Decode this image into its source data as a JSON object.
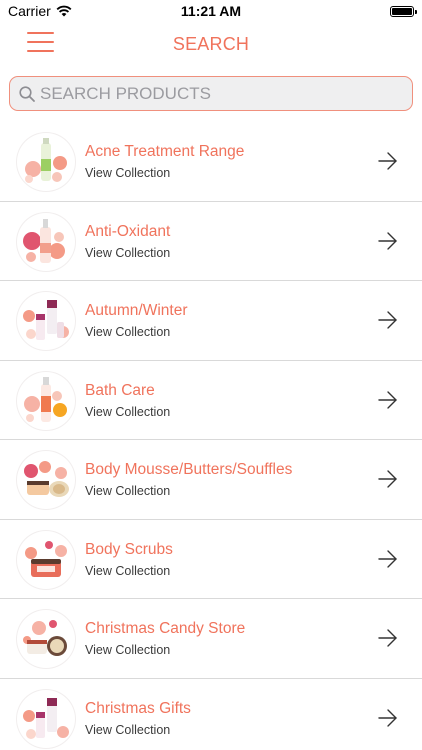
{
  "status_bar": {
    "carrier": "Carrier",
    "time": "11:21 AM"
  },
  "nav": {
    "title": "SEARCH",
    "menu_icon": "hamburger-menu-icon"
  },
  "search": {
    "placeholder": "SEARCH PRODUCTS",
    "value": ""
  },
  "collections": [
    {
      "title": "Acne Treatment Range",
      "subtitle": "View Collection",
      "thumbnail": "bottle-with-flowers"
    },
    {
      "title": "Anti-Oxidant",
      "subtitle": "View Collection",
      "thumbnail": "spray-bottle-with-flowers"
    },
    {
      "title": "Autumn/Winter",
      "subtitle": "View Collection",
      "thumbnail": "product-set-with-flowers"
    },
    {
      "title": "Bath Care",
      "subtitle": "View Collection",
      "thumbnail": "tall-bottle-with-flowers"
    },
    {
      "title": "Body Mousse/Butters/Souffles",
      "subtitle": "View Collection",
      "thumbnail": "jars-with-flowers"
    },
    {
      "title": "Body Scrubs",
      "subtitle": "View Collection",
      "thumbnail": "scrub-jar-with-flowers"
    },
    {
      "title": "Christmas Candy Store",
      "subtitle": "View Collection",
      "thumbnail": "tins-with-flowers"
    },
    {
      "title": "Christmas Gifts",
      "subtitle": "View Collection",
      "thumbnail": "gift-set-with-flowers"
    }
  ],
  "colors": {
    "accent": "#f0735c",
    "search_border": "#f0907d",
    "search_bg": "#efeff0",
    "divider": "#d9d9d9"
  }
}
